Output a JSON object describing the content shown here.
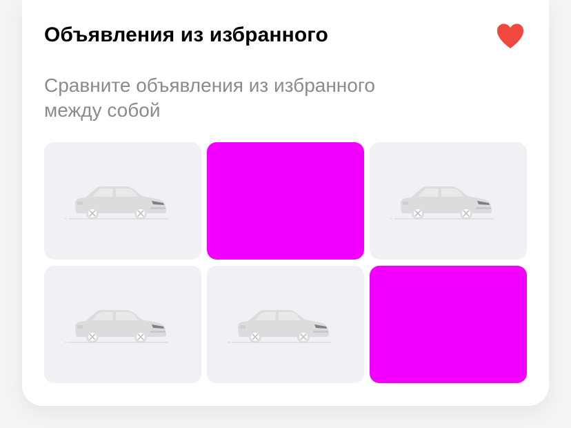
{
  "card": {
    "title": "Объявления из избранного",
    "subtitle": "Сравните объявления из избранного между собой",
    "heart_icon": "heart-icon",
    "heart_color": "#f0483e"
  },
  "grid": {
    "tiles": [
      {
        "type": "placeholder",
        "icon": "car-placeholder-icon"
      },
      {
        "type": "photo",
        "color": "#f200ff"
      },
      {
        "type": "placeholder",
        "icon": "car-placeholder-icon"
      },
      {
        "type": "placeholder",
        "icon": "car-placeholder-icon"
      },
      {
        "type": "placeholder",
        "icon": "car-placeholder-icon"
      },
      {
        "type": "photo",
        "color": "#f200ff"
      }
    ]
  }
}
